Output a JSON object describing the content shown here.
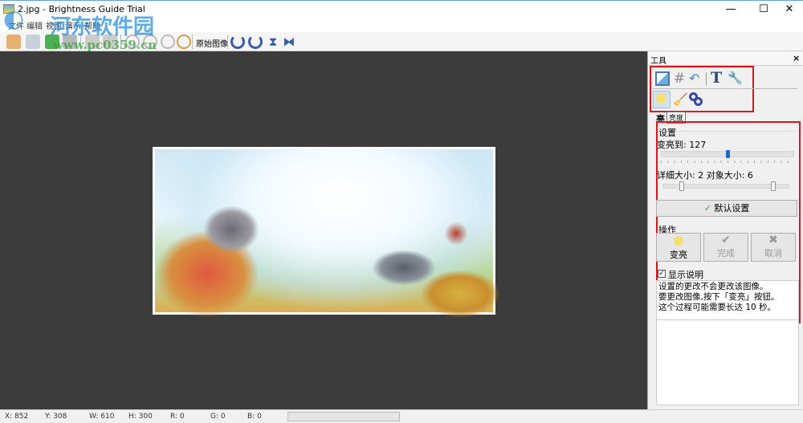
{
  "window": {
    "title": "2.jpg - Brightness Guide Trial",
    "minimize": "—",
    "maximize": "☐",
    "close": "✕"
  },
  "menu": [
    "文件",
    "编辑",
    "视图",
    "演示",
    "帮助"
  ],
  "toolbar": {
    "original_image": "原始图像"
  },
  "watermark": {
    "name": "河东软件园",
    "url": "www.pc0359.cn"
  },
  "panel": {
    "title": "工具",
    "close": "×",
    "section_label": "亮",
    "tooltip": "亮度",
    "settings": {
      "title": "设置",
      "brighten_label": "变亮到: 127",
      "brighten_value": 127,
      "brighten_max": 255,
      "sizes_label": "详细大小: 2  对象大小: 6",
      "default_button": "默认设置"
    },
    "actions": {
      "title": "操作",
      "brighten": "变亮",
      "done": "完成",
      "cancel": "取消"
    },
    "show_desc": {
      "label": "显示说明",
      "checked": true
    },
    "description": "设置的更改不会更改该图像。\n要更改图像,按下「变亮」按钮。\n这个过程可能需要长达 10 秒。"
  },
  "status": {
    "x": "X: 852",
    "y": "Y: 308",
    "w": "W: 610",
    "h": "H: 300",
    "r": "R: 0",
    "g": "G: 0",
    "b": "B: 0"
  }
}
